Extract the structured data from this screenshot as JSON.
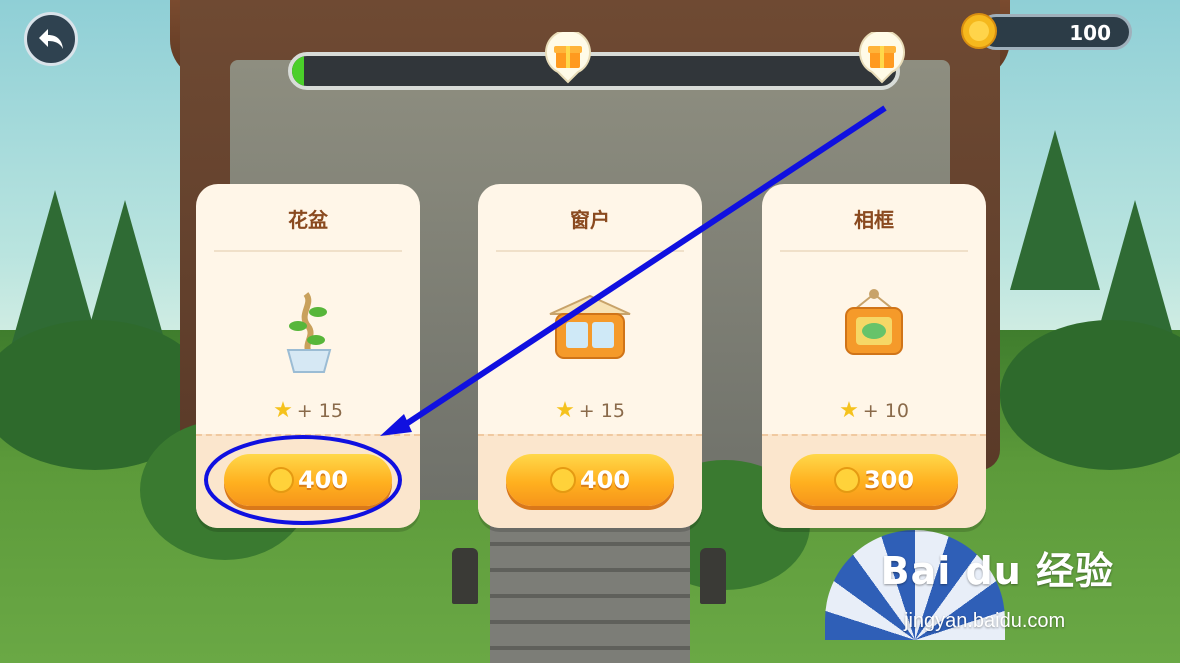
{
  "hud": {
    "back_icon": "back-arrow-icon",
    "coins": "100",
    "coin_icon": "coin-icon",
    "progress_fraction": 0.02,
    "milestone_icon": "gift-box-icon"
  },
  "shop": {
    "items": [
      {
        "title": "花盆",
        "icon": "flower-pot-icon",
        "stars": "+ 15",
        "price": "400"
      },
      {
        "title": "窗户",
        "icon": "window-icon",
        "stars": "+ 15",
        "price": "400"
      },
      {
        "title": "相框",
        "icon": "picture-frame-icon",
        "stars": "+ 10",
        "price": "300"
      }
    ]
  },
  "watermark": {
    "brand": "Bai  du 经验",
    "url": "jingyan.baidu.com"
  },
  "colors": {
    "accent": "#ffb01f",
    "annotation": "#1010e0",
    "progress": "#4bcf2a"
  }
}
